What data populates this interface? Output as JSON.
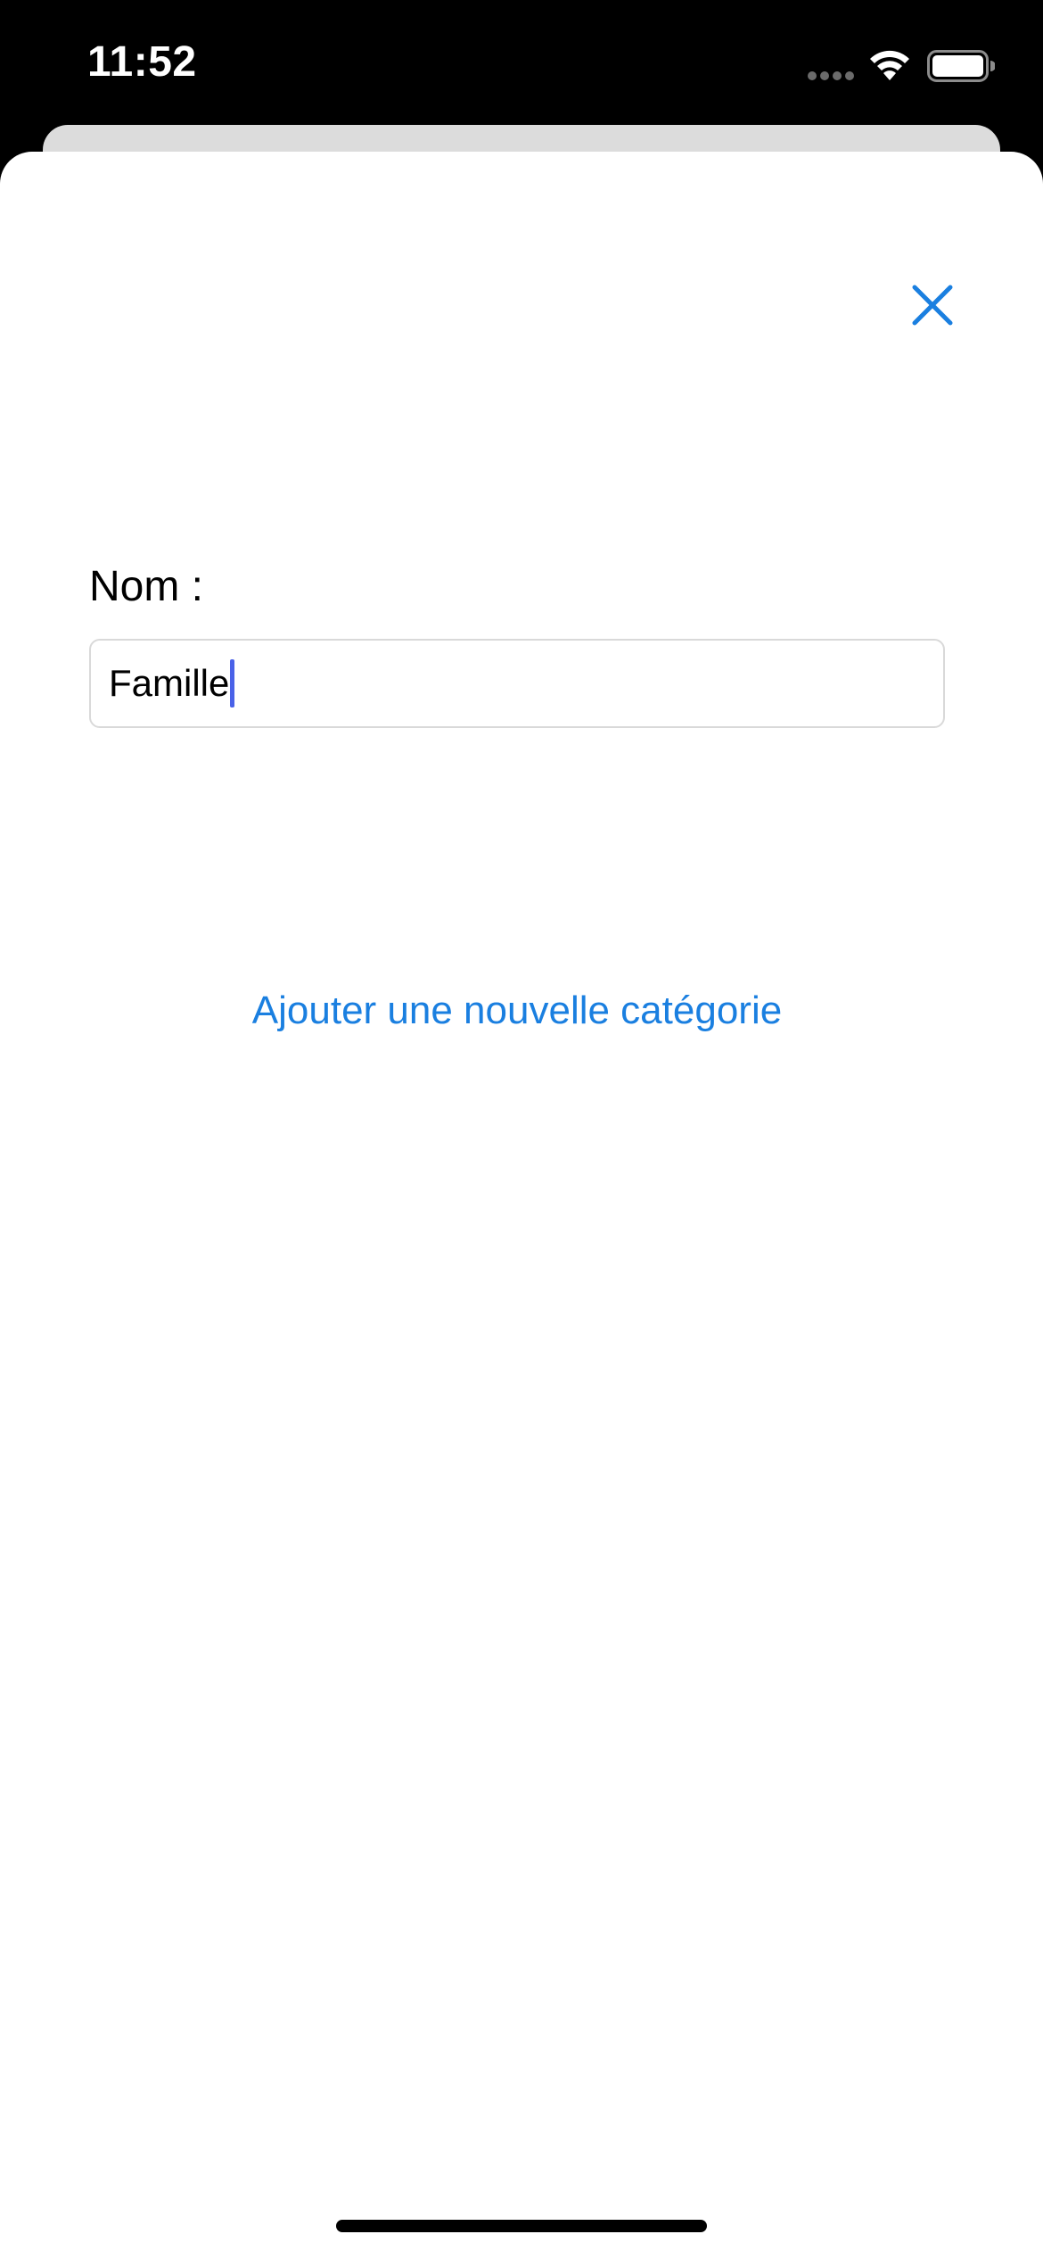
{
  "status_bar": {
    "time": "11:52",
    "text_color": "#ffffff",
    "icons": [
      "cellular-signal-icon",
      "wifi-icon",
      "battery-icon"
    ]
  },
  "sheet": {
    "close_icon": "close-icon",
    "name_label": "Nom :",
    "name_input": {
      "value": "Famille",
      "placeholder": ""
    },
    "add_category_label": "Ajouter une nouvelle catégorie"
  },
  "colors": {
    "accent": "#1a7fe0",
    "cursor": "#4a62e8",
    "background": "#000000",
    "sheet": "#ffffff",
    "back_sheet": "#dcdcdc"
  }
}
